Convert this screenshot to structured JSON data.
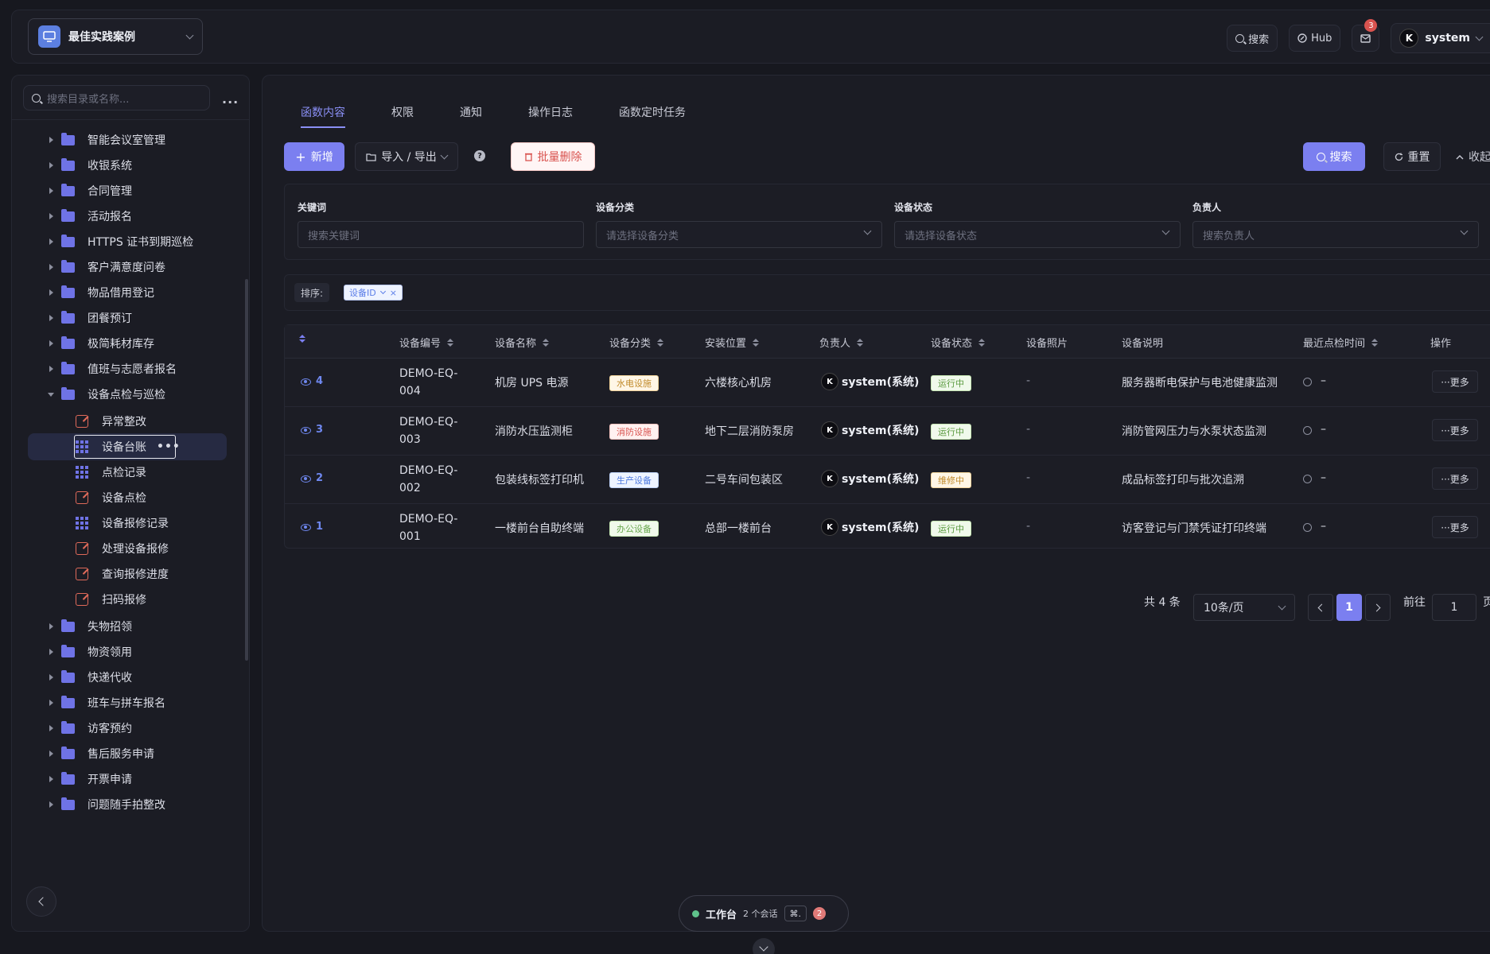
{
  "header": {
    "app_name": "最佳实践案例",
    "search_label": "搜索",
    "hub_label": "Hub",
    "mail_badge": "3",
    "user_avatar": "K",
    "user_name": "system"
  },
  "sidebar": {
    "search_placeholder": "搜索目录或名称...",
    "more": "...",
    "items": [
      {
        "label": "智能会议室管理",
        "type": "folder"
      },
      {
        "label": "收银系统",
        "type": "folder"
      },
      {
        "label": "合同管理",
        "type": "folder"
      },
      {
        "label": "活动报名",
        "type": "folder"
      },
      {
        "label": "HTTPS 证书到期巡检",
        "type": "folder"
      },
      {
        "label": "客户满意度问卷",
        "type": "folder"
      },
      {
        "label": "物品借用登记",
        "type": "folder"
      },
      {
        "label": "团餐预订",
        "type": "folder"
      },
      {
        "label": "极简耗材库存",
        "type": "folder"
      },
      {
        "label": "值班与志愿者报名",
        "type": "folder"
      },
      {
        "label": "设备点检与巡检",
        "type": "folder-open"
      },
      {
        "label": "异常整改",
        "type": "edit"
      },
      {
        "label": "设备台账",
        "type": "grid",
        "selected": true
      },
      {
        "label": "点检记录",
        "type": "grid"
      },
      {
        "label": "设备点检",
        "type": "edit"
      },
      {
        "label": "设备报修记录",
        "type": "grid"
      },
      {
        "label": "处理设备报修",
        "type": "edit"
      },
      {
        "label": "查询报修进度",
        "type": "edit"
      },
      {
        "label": "扫码报修",
        "type": "edit"
      },
      {
        "label": "失物招领",
        "type": "folder"
      },
      {
        "label": "物资领用",
        "type": "folder"
      },
      {
        "label": "快递代收",
        "type": "folder"
      },
      {
        "label": "班车与拼车报名",
        "type": "folder"
      },
      {
        "label": "访客预约",
        "type": "folder"
      },
      {
        "label": "售后服务申请",
        "type": "folder"
      },
      {
        "label": "开票申请",
        "type": "folder"
      },
      {
        "label": "问题随手拍整改",
        "type": "folder"
      }
    ]
  },
  "tabs": [
    "函数内容",
    "权限",
    "通知",
    "操作日志",
    "函数定时任务"
  ],
  "toolbar": {
    "add": "新增",
    "import_export": "导入 / 导出",
    "help": "?",
    "bulk_delete": "批量删除",
    "search": "搜索",
    "reset": "重置",
    "collapse": "收起"
  },
  "filters": [
    {
      "label": "关键词",
      "placeholder": "搜索关键词",
      "select": false
    },
    {
      "label": "设备分类",
      "placeholder": "请选择设备分类",
      "select": true
    },
    {
      "label": "设备状态",
      "placeholder": "请选择设备状态",
      "select": true
    },
    {
      "label": "负责人",
      "placeholder": "搜索负责人",
      "select": true
    }
  ],
  "sort": {
    "label": "排序:",
    "tag": "设备ID",
    "close": "×"
  },
  "table": {
    "columns": [
      "设备编号",
      "设备名称",
      "设备分类",
      "安装位置",
      "负责人",
      "设备状态",
      "设备照片",
      "设备说明",
      "最近点检时间",
      "操作"
    ],
    "rows": [
      {
        "id": "4",
        "code_a": "DEMO-EQ-",
        "code_b": "004",
        "name": "机房 UPS 电源",
        "category": "水电设施",
        "cat_color": "yellow",
        "location": "六楼核心机房",
        "owner_av": "K",
        "owner": "system(系统)",
        "status": "运行中",
        "status_color": "g",
        "photo": "-",
        "desc": "服务器断电保护与电池健康监测",
        "last": "–",
        "action": "···更多"
      },
      {
        "id": "3",
        "code_a": "DEMO-EQ-",
        "code_b": "003",
        "name": "消防水压监测柜",
        "category": "消防设施",
        "cat_color": "red",
        "location": "地下二层消防泵房",
        "owner_av": "K",
        "owner": "system(系统)",
        "status": "运行中",
        "status_color": "g",
        "photo": "-",
        "desc": "消防管网压力与水泵状态监测",
        "last": "–",
        "action": "···更多"
      },
      {
        "id": "2",
        "code_a": "DEMO-EQ-",
        "code_b": "002",
        "name": "包装线标签打印机",
        "category": "生产设备",
        "cat_color": "blue",
        "location": "二号车间包装区",
        "owner_av": "K",
        "owner": "system(系统)",
        "status": "维修中",
        "status_color": "o",
        "photo": "-",
        "desc": "成品标签打印与批次追溯",
        "last": "–",
        "action": "···更多"
      },
      {
        "id": "1",
        "code_a": "DEMO-EQ-",
        "code_b": "001",
        "name": "一楼前台自助终端",
        "category": "办公设备",
        "cat_color": "green",
        "location": "总部一楼前台",
        "owner_av": "K",
        "owner": "system(系统)",
        "status": "运行中",
        "status_color": "g",
        "photo": "-",
        "desc": "访客登记与门禁凭证打印终端",
        "last": "–",
        "action": "···更多"
      }
    ]
  },
  "pagination": {
    "total": "共 4 条",
    "page_size": "10条/页",
    "current": "1",
    "goto_label": "前往",
    "goto_value": "1",
    "page_suffix": "页"
  },
  "workbench": {
    "title": "工作台",
    "sessions": "2 个会话",
    "shortcut": "⌘.",
    "badge": "2"
  }
}
